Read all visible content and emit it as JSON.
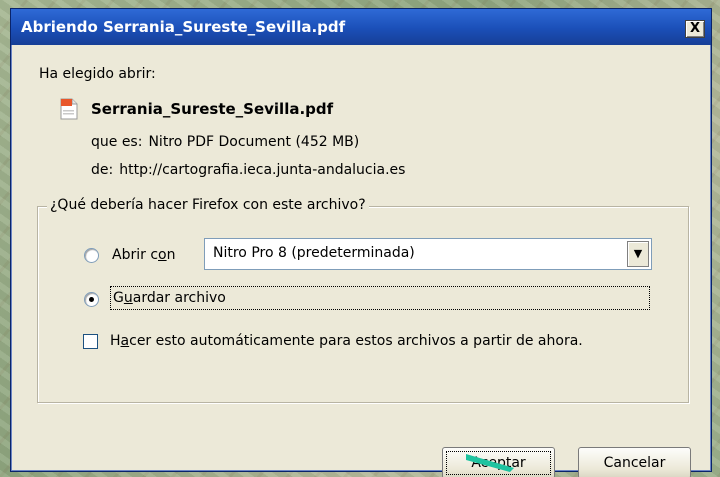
{
  "window": {
    "title": "Abriendo Serrania_Sureste_Sevilla.pdf",
    "close_label": "X"
  },
  "content": {
    "chose_label": "Ha elegido abrir:",
    "file_name": "Serrania_Sureste_Sevilla.pdf",
    "type_label": "que es:",
    "type_value": "Nitro PDF Document (452 MB)",
    "from_label": "de:",
    "from_value": "http://cartografia.ieca.junta-andalucia.es"
  },
  "group": {
    "legend": "¿Qué debería hacer Firefox con este archivo?",
    "open_with_label_pre": "Abrir c",
    "open_with_label_u": "o",
    "open_with_label_post": "n",
    "open_with_app": "Nitro Pro 8 (predeterminada)",
    "save_label_pre": "G",
    "save_label_u": "u",
    "save_label_post": "ardar archivo",
    "selected_option": "save",
    "auto_label_pre": "H",
    "auto_label_u": "a",
    "auto_label_post": "cer esto automáticamente para estos archivos a partir de ahora.",
    "auto_checked": false
  },
  "buttons": {
    "ok": "Aceptar",
    "cancel": "Cancelar"
  },
  "colors": {
    "titlebar": "#1b4fb8",
    "dialog_bg": "#ece9d8",
    "pointer": "#1ec3a0"
  }
}
